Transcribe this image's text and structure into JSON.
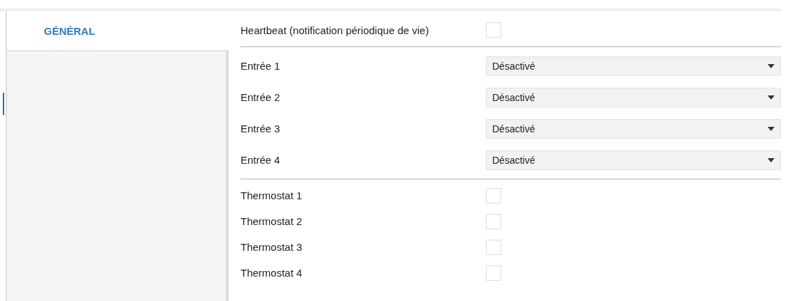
{
  "sidebar": {
    "tabs": [
      {
        "label": "GÉNÉRAL",
        "selected": true
      }
    ]
  },
  "groups": [
    {
      "rows": [
        {
          "kind": "checkbox",
          "label": "Heartbeat (notification périodique de vie)",
          "checked": false
        }
      ]
    },
    {
      "rows": [
        {
          "kind": "dropdown",
          "label": "Entrée 1",
          "value": "Désactivé"
        },
        {
          "kind": "dropdown",
          "label": "Entrée 2",
          "value": "Désactivé"
        },
        {
          "kind": "dropdown",
          "label": "Entrée 3",
          "value": "Désactivé"
        },
        {
          "kind": "dropdown",
          "label": "Entrée 4",
          "value": "Désactivé"
        }
      ]
    },
    {
      "rows": [
        {
          "kind": "checkbox",
          "label": "Thermostat 1",
          "checked": false
        },
        {
          "kind": "checkbox",
          "label": "Thermostat 2",
          "checked": false
        },
        {
          "kind": "checkbox",
          "label": "Thermostat 3",
          "checked": false
        },
        {
          "kind": "checkbox",
          "label": "Thermostat 4",
          "checked": false
        }
      ]
    }
  ]
}
